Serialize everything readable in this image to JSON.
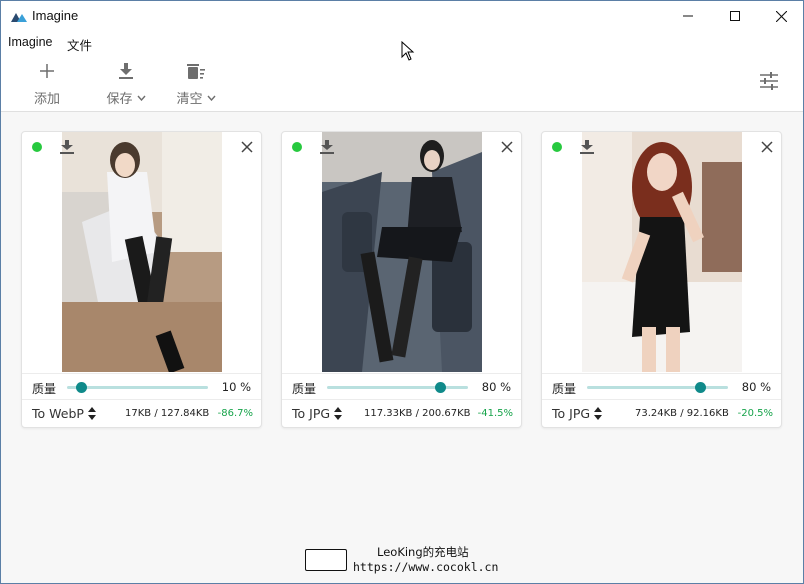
{
  "window": {
    "title": "Imagine"
  },
  "menu": {
    "items": [
      "Imagine",
      "文件"
    ]
  },
  "toolbar": {
    "add_label": "添加",
    "save_label": "保存",
    "clear_label": "清空"
  },
  "cards": [
    {
      "status": "done",
      "quality_label": "质量",
      "quality": 10,
      "quality_text": "10 %",
      "format": "To WebP",
      "sizes": "17KB / 127.84KB",
      "reduction": "-86.7%",
      "image_kind": "photo"
    },
    {
      "status": "done",
      "quality_label": "质量",
      "quality": 80,
      "quality_text": "80 %",
      "format": "To JPG",
      "sizes": "117.33KB / 200.67KB",
      "reduction": "-41.5%",
      "image_kind": "photo"
    },
    {
      "status": "done",
      "quality_label": "质量",
      "quality": 80,
      "quality_text": "80 %",
      "format": "To JPG",
      "sizes": "73.24KB / 92.16KB",
      "reduction": "-20.5%",
      "image_kind": "photo"
    }
  ],
  "watermark": {
    "line1": "LeoKing的充电站",
    "line2": "https://www.cocokl.cn"
  },
  "colors": {
    "status_green": "#27c93f",
    "slider_track": "#b9e0df",
    "slider_thumb": "#0f8a8a",
    "reduction_green": "#16a34a"
  }
}
